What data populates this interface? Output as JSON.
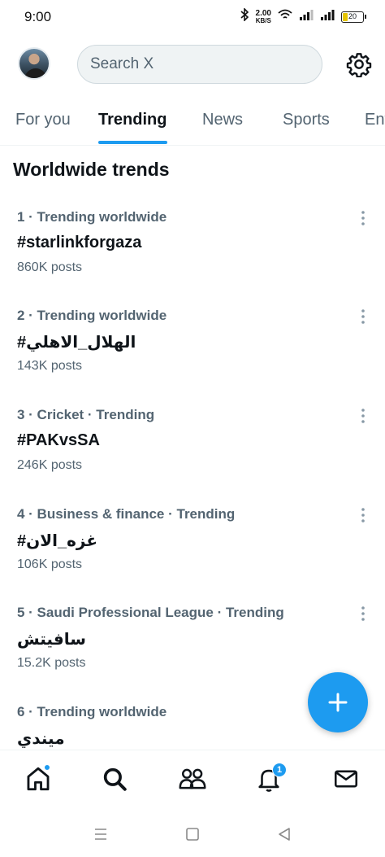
{
  "status_bar": {
    "time": "9:00",
    "net_speed_value": "2.00",
    "net_speed_unit": "KB/S",
    "battery": "20"
  },
  "header": {
    "search_placeholder": "Search X"
  },
  "tabs": [
    {
      "label": "For you",
      "active": false
    },
    {
      "label": "Trending",
      "active": true
    },
    {
      "label": "News",
      "active": false
    },
    {
      "label": "Sports",
      "active": false
    },
    {
      "label": "Ent",
      "active": false
    }
  ],
  "section_title": "Worldwide trends",
  "trends": [
    {
      "meta": "1 · Trending worldwide",
      "name": "#starlinkforgaza",
      "count": "860K posts"
    },
    {
      "meta": "2 · Trending worldwide",
      "name": "#الهلال_الاهلي",
      "count": "143K posts"
    },
    {
      "meta": "3 · Cricket · Trending",
      "name": "#PAKvsSA",
      "count": "246K posts"
    },
    {
      "meta": "4 · Business & finance · Trending",
      "name": "#غزه_الان",
      "count": "106K posts"
    },
    {
      "meta": "5 · Saudi Professional League · Trending",
      "name": "سافيتش",
      "count": "15.2K posts"
    },
    {
      "meta": "6 · Trending worldwide",
      "name": "ميندي",
      "count": ""
    }
  ],
  "bottom_nav": {
    "notifications_badge": "1"
  },
  "colors": {
    "accent": "#1d9bf0",
    "text_primary": "#0f1419",
    "text_secondary": "#536471"
  }
}
